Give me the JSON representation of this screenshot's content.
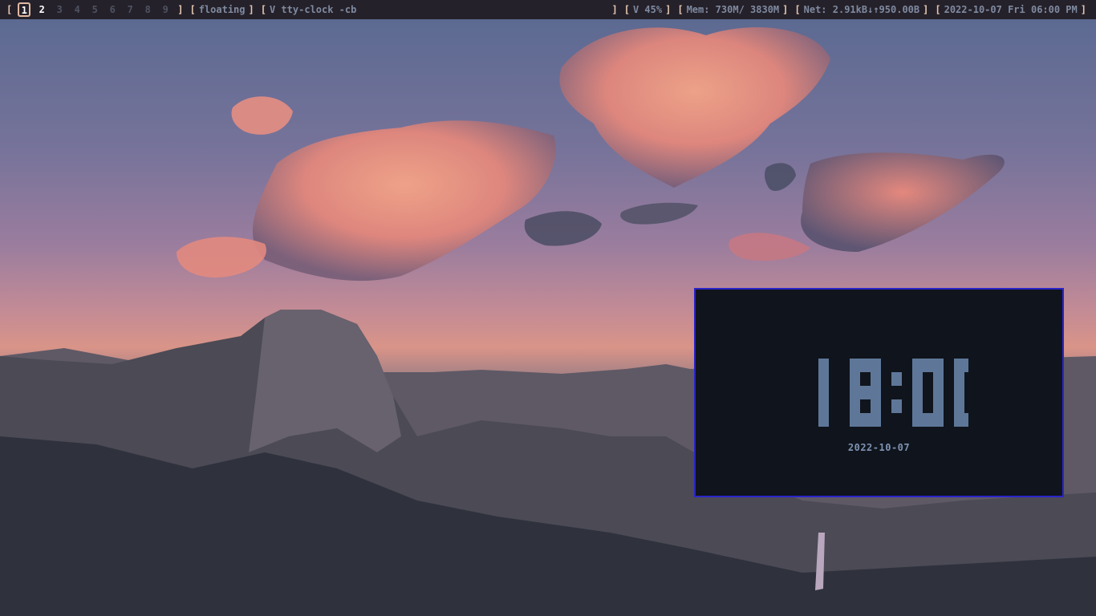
{
  "taskbar": {
    "workspaces": [
      "1",
      "2",
      "3",
      "4",
      "5",
      "6",
      "7",
      "8",
      "9"
    ],
    "layout": "floating",
    "window_title": "V tty-clock -cb",
    "volume": "V 45%",
    "memory": "Mem: 730M/ 3830M",
    "network": "Net: 2.91kB↓↑950.00B",
    "datetime": "2022-10-07 Fri 06:00 PM"
  },
  "clock_window": {
    "time": "18:00",
    "date": "2022-10-07",
    "digit_color": "#5e7799"
  },
  "colors": {
    "bar_bg": "#25212a",
    "bracket": "#e6c8b2",
    "window_border": "#2a24c8",
    "window_bg": "#10141c"
  }
}
